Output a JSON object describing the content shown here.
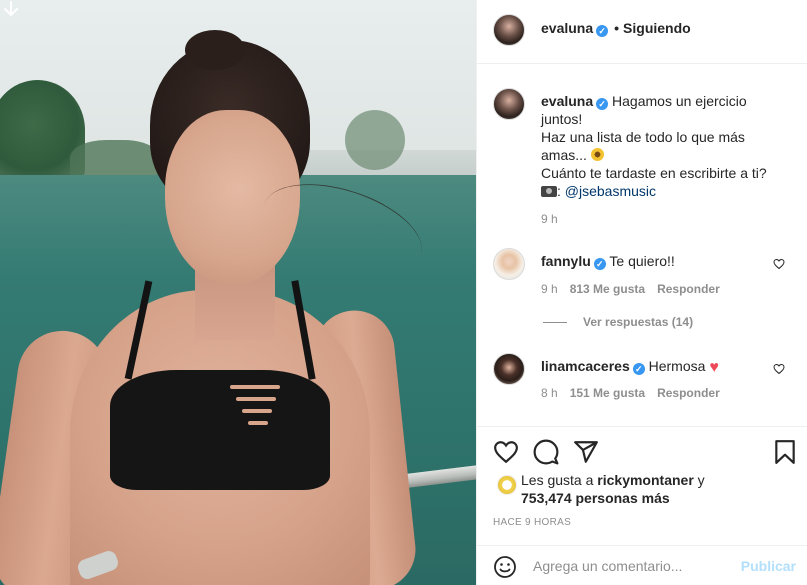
{
  "header": {
    "username": "evaluna",
    "separator": "•",
    "follow_status": "Siguiendo"
  },
  "caption": {
    "username": "evaluna",
    "text_1": "Hagamos un ejercicio juntos!",
    "text_2": "Haz una lista de todo lo que más amas...",
    "text_3": "Cuánto te tardaste en escribirte a ti?",
    "credit": "@jsebasmusic",
    "time": "9 h"
  },
  "comments": [
    {
      "username": "fannylu",
      "text": "Te quiero!!",
      "time": "9 h",
      "likes": "813 Me gusta",
      "reply": "Responder",
      "view_replies": "Ver respuestas (14)"
    },
    {
      "username": "linamcaceres",
      "text": "Hermosa",
      "time": "8 h",
      "likes": "151 Me gusta",
      "reply": "Responder"
    }
  ],
  "likes": {
    "prefix": "Les gusta a",
    "user": "rickymontaner",
    "connector": "y",
    "count": "753,474 personas más"
  },
  "timestamp": "HACE 9 HORAS",
  "add_comment": {
    "placeholder": "Agrega un comentario...",
    "publish": "Publicar"
  },
  "colors": {
    "verified": "#3897f0",
    "publish_disabled": "#b2dffc",
    "secondary_text": "#8e8e8e",
    "link": "#00376b"
  }
}
